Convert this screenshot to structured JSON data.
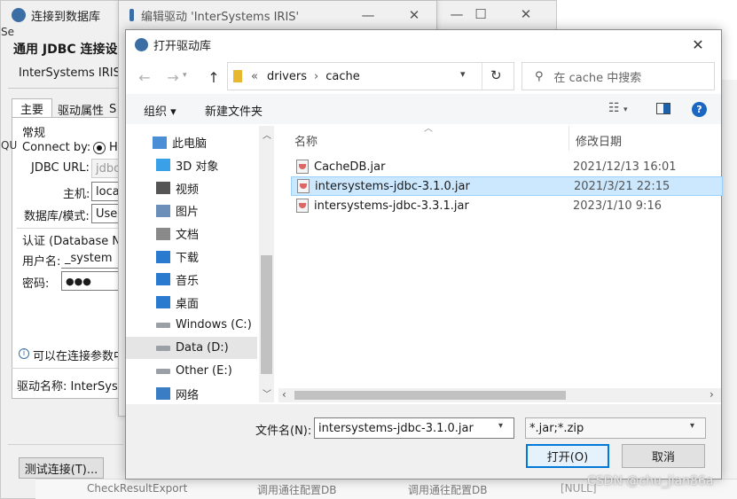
{
  "bg_window": {
    "title": "连接到数据库",
    "section_title": "通用 JDBC 连接设",
    "subtitle": "InterSystems IRIS 连",
    "tabs": [
      "主要",
      "驱动属性",
      "S"
    ],
    "group_title": "常规",
    "connect_by_label": "Connect by:",
    "connect_by_value": "H",
    "jdbc_url_label": "JDBC URL:",
    "jdbc_url_value": "jdbc",
    "host_label": "主机:",
    "host_value": "loca",
    "db_label": "数据库/模式:",
    "db_value": "User",
    "auth_title": "认证 (Database Na",
    "user_label": "用户名:",
    "user_value": "_system",
    "pass_label": "密码:",
    "pass_value": "●●●",
    "info_text": "可以在连接参数中",
    "driver_label": "驱动名称: InterSyster",
    "test_button": "测试连接(T)...",
    "left_edge_text": "Se",
    "left_edge_text2": "QU"
  },
  "mid_window": {
    "title": "编辑驱动 'InterSystems IRIS'"
  },
  "bottom_strip": {
    "item": "CheckResultExport",
    "col1": "调用通往配置DB",
    "col2": "调用通往配置DB",
    "null_text": "[NULL]"
  },
  "dialog": {
    "title": "打开驱动库",
    "breadcrumb": {
      "prefix": "«",
      "parts": [
        "drivers",
        "cache"
      ]
    },
    "search_placeholder": "在 cache 中搜索",
    "toolbar": {
      "organize": "组织 ▾",
      "new_folder": "新建文件夹"
    },
    "columns": {
      "name": "名称",
      "modified": "修改日期"
    },
    "nav_items": [
      {
        "label": "此电脑",
        "icon": "computer-icon"
      },
      {
        "label": "3D 对象",
        "icon": "cube-icon"
      },
      {
        "label": "视频",
        "icon": "video-icon"
      },
      {
        "label": "图片",
        "icon": "picture-icon"
      },
      {
        "label": "文档",
        "icon": "document-icon"
      },
      {
        "label": "下载",
        "icon": "download-icon"
      },
      {
        "label": "音乐",
        "icon": "music-icon"
      },
      {
        "label": "桌面",
        "icon": "desktop-icon"
      },
      {
        "label": "Windows (C:)",
        "icon": "drive-icon"
      },
      {
        "label": "Data (D:)",
        "icon": "drive-icon"
      },
      {
        "label": "Other (E:)",
        "icon": "drive-icon"
      },
      {
        "label": "网络",
        "icon": "network-icon"
      }
    ],
    "selected_nav": "Data (D:)",
    "files": [
      {
        "name": "CacheDB.jar",
        "date": "2021/12/13 16:01"
      },
      {
        "name": "intersystems-jdbc-3.1.0.jar",
        "date": "2021/3/21 22:15"
      },
      {
        "name": "intersystems-jdbc-3.3.1.jar",
        "date": "2023/1/10 9:16"
      }
    ],
    "selected_file": "intersystems-jdbc-3.1.0.jar",
    "filename_label": "文件名(N):",
    "filename_value": "intersystems-jdbc-3.1.0.jar",
    "filter_value": "*.jar;*.zip",
    "open_button": "打开(O)",
    "cancel_button": "取消"
  },
  "watermark": "CSDN @chu_jian86a",
  "colors": {
    "accent": "#0078d7",
    "selected_row": "#cce8ff",
    "nav_selected": "#cde8ff"
  }
}
